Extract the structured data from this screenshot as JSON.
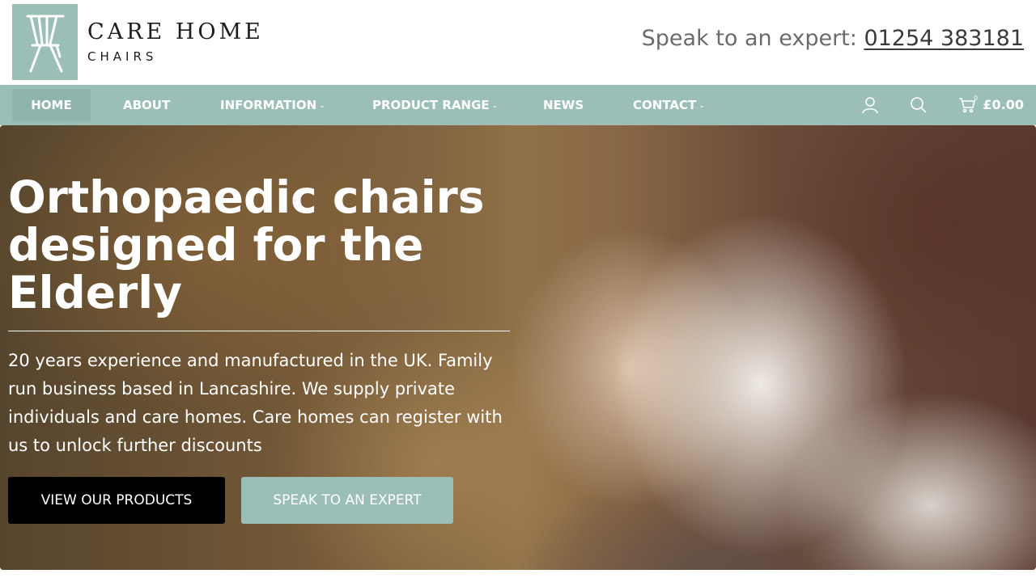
{
  "header": {
    "logo_line1": "CARE HOME",
    "logo_line2": "CHAIRS",
    "expert_label": "Speak to an expert: ",
    "expert_phone": "01254 383181"
  },
  "nav": {
    "items": [
      {
        "label": "HOME",
        "active": true,
        "dropdown": false
      },
      {
        "label": "ABOUT",
        "active": false,
        "dropdown": false
      },
      {
        "label": "INFORMATION",
        "active": false,
        "dropdown": true
      },
      {
        "label": "PRODUCT RANGE",
        "active": false,
        "dropdown": true
      },
      {
        "label": "NEWS",
        "active": false,
        "dropdown": false
      },
      {
        "label": "CONTACT",
        "active": false,
        "dropdown": true
      }
    ],
    "icons": [
      "user-icon",
      "search-icon",
      "cart-icon"
    ],
    "cart_count": "0",
    "cart_total": "£0.00"
  },
  "hero": {
    "title": "Orthopaedic chairs designed for the Elderly",
    "description": "20 years experience and manufactured in the UK. Family run business based in Lancashire. We supply private individuals and care homes. Care homes can register with us to unlock further discounts",
    "primary_button": "VIEW OUR PRODUCTS",
    "secondary_button": "SPEAK TO AN EXPERT"
  },
  "colors": {
    "accent": "#9bbfb7",
    "primary_button": "#000000",
    "text_dark": "#1d1d1d"
  }
}
